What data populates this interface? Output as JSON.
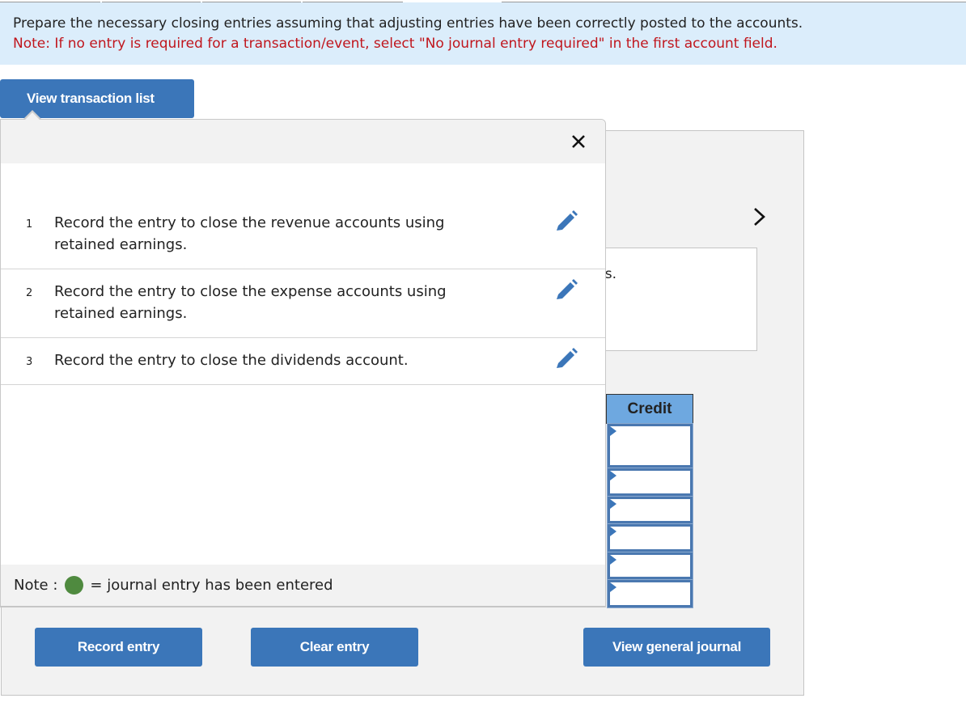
{
  "instructions": {
    "line1": "Prepare the necessary closing entries assuming that adjusting entries have been correctly posted to the accounts.",
    "line2": "Note: If no entry is required for a transaction/event, select \"No journal entry required\" in the first account field."
  },
  "toolbar": {
    "view_transaction_list_label": "View transaction list"
  },
  "transaction_list": {
    "close_icon": "close-icon",
    "items": [
      {
        "number": "1",
        "text": "Record the entry to close the revenue accounts using retained earnings.",
        "icon": "pencil-icon"
      },
      {
        "number": "2",
        "text": "Record the entry to close the expense accounts using retained earnings.",
        "icon": "pencil-icon"
      },
      {
        "number": "3",
        "text": "Record the entry to close the dividends account.",
        "icon": "pencil-icon"
      }
    ],
    "note": {
      "prefix": "Note :",
      "suffix": "= journal entry has been entered",
      "dot_color": "#4f8a3f"
    }
  },
  "worksheet": {
    "next_icon": "chevron-right-icon",
    "description_visible_fragment": "gs.",
    "credit_header": "Credit",
    "credit_rows": 6
  },
  "actions": {
    "record_entry_label": "Record entry",
    "clear_entry_label": "Clear entry",
    "view_general_journal_label": "View general journal"
  },
  "colors": {
    "button_blue": "#3b76b9",
    "instruction_bg": "#dbedfb",
    "note_red": "#c0161d",
    "credit_header_bg": "#6ea8e0"
  }
}
